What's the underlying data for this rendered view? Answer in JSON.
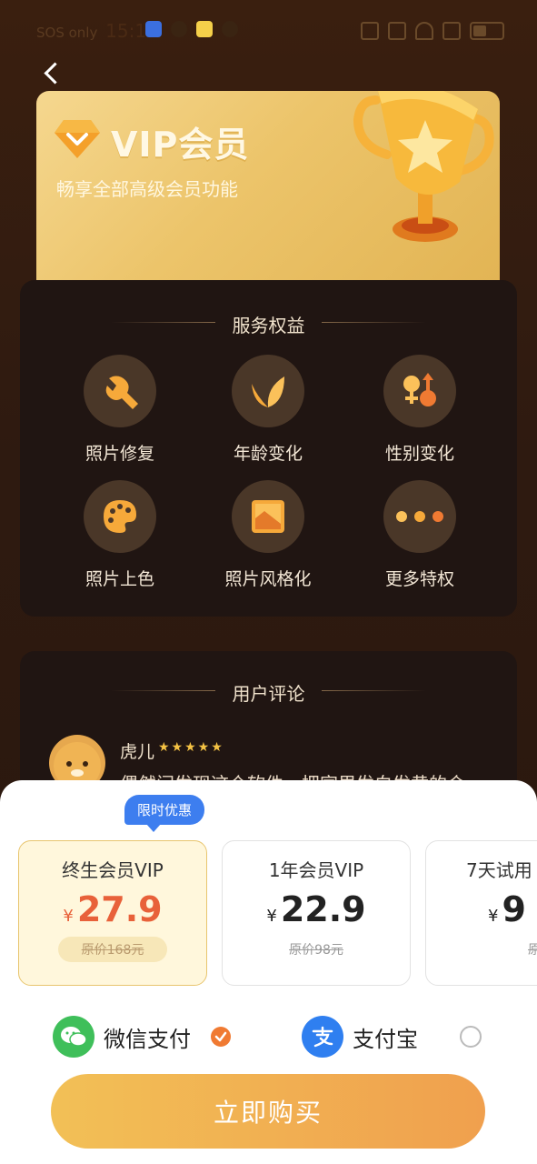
{
  "status_bar": {
    "carrier": "SOS only",
    "time": "15:14"
  },
  "vip": {
    "title": "VIP会员",
    "subtitle": "畅享全部高级会员功能"
  },
  "services": {
    "title": "服务权益",
    "items": [
      {
        "label": "照片修复",
        "icon": "wrench-icon"
      },
      {
        "label": "年龄变化",
        "icon": "leaf-icon"
      },
      {
        "label": "性别变化",
        "icon": "gender-icon"
      },
      {
        "label": "照片上色",
        "icon": "palette-icon"
      },
      {
        "label": "照片风格化",
        "icon": "picture-icon"
      },
      {
        "label": "更多特权",
        "icon": "more-icon"
      }
    ]
  },
  "reviews": {
    "title": "用户评论",
    "items": [
      {
        "name": "虎儿",
        "stars": "★★★★★",
        "rating": 5,
        "text": "偶然间发现这个软件，把家里发白发黄的合"
      }
    ]
  },
  "plans": {
    "badge": "限时优惠",
    "currency": "¥",
    "items": [
      {
        "name": "终生会员VIP",
        "price": "27.9",
        "original": "原价168元",
        "selected": true
      },
      {
        "name": "1年会员VIP",
        "price": "22.9",
        "original": "原价98元",
        "selected": false
      },
      {
        "name": "7天试用",
        "price": "9",
        "original": "原价",
        "selected": false
      }
    ]
  },
  "payment": {
    "wechat": {
      "label": "微信支付",
      "selected": true
    },
    "alipay": {
      "label": "支付宝",
      "selected": false
    }
  },
  "buy_button": "立即购买",
  "colors": {
    "accent": "#e8613a",
    "gold": "#ecc46a",
    "blue_badge": "#3d7eef",
    "wechat": "#3fbf5a",
    "alipay": "#2f7ff0"
  }
}
